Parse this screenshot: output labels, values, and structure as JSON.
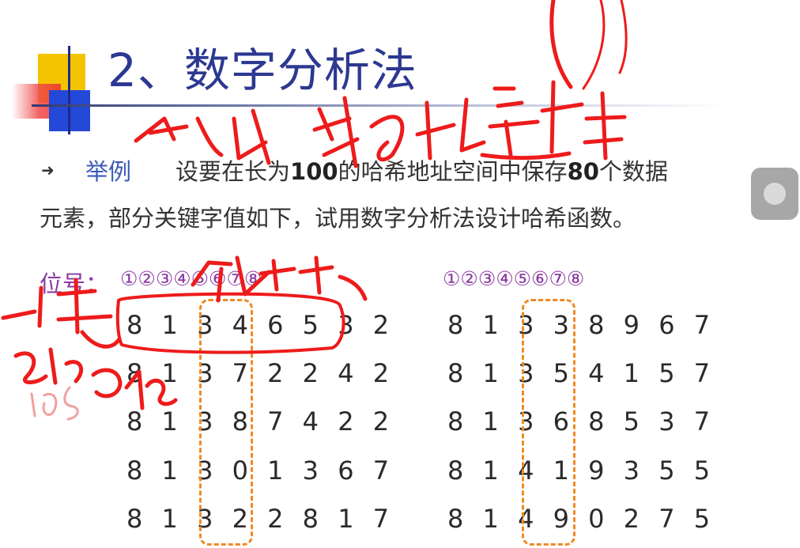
{
  "title": "2、数字分析法",
  "example": {
    "label": "举例",
    "line1_a": "设要在长为",
    "line1_b": "100",
    "line1_c": "的哈希地址空间中保存",
    "line1_d": "80",
    "line1_e": "个数据",
    "line2": "元素，部分关键字值如下，试用数字分析法设计哈希函数。"
  },
  "positions": {
    "label": "位号：",
    "left_digits": "①②③④⑤⑥⑦⑧",
    "right_digits": "①②③④⑤⑥⑦⑧"
  },
  "keys_left": [
    "8 1 3 4 6 5 3 2",
    "8 1 3 7 2 2 4 2",
    "8 1 3 8 7 4 2 2",
    "8 1 3 0 1 3 6 7",
    "8 1 3 2 2 8 1 7"
  ],
  "keys_right": [
    "8 1 3 3 8 9 6 7",
    "8 1 3 5 4 1 5 7",
    "8 1 3 6 8 5 3 7",
    "8 1 4 1 9 3 5 5",
    "8 1 4 9 0 2 7 5"
  ],
  "colors": {
    "title": "#2c3891",
    "example_label": "#3b59b8",
    "position": "#8b3aa0",
    "dashed_box": "#f08a24",
    "ink": "#ee1b1b"
  }
}
